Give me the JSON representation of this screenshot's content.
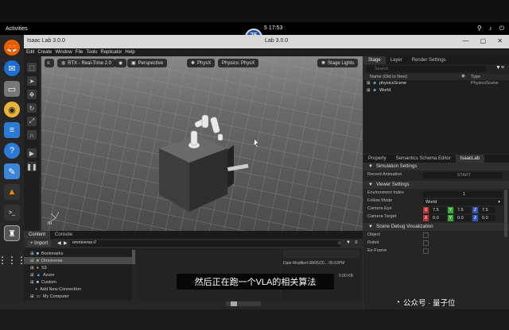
{
  "system": {
    "activities": "Activities",
    "clock": "5 17:53",
    "badge_value": "75",
    "badge_unit": "fps",
    "tray_icons": [
      "network-icon",
      "volume-icon",
      "power-icon"
    ]
  },
  "window": {
    "title": "Isaac Lab 3.0.0",
    "center_title": "Lab 3.0.0",
    "controls": [
      "minimize",
      "maximize",
      "close"
    ]
  },
  "menubar": [
    "Edit",
    "Create",
    "Window",
    "File",
    "Tools",
    "Replicator",
    "Help"
  ],
  "viewport": {
    "renderer": "RTX - Real-Time 2.0",
    "camera": "Perspective",
    "physx": "PhysX",
    "physics": "Physics: PhysX",
    "lights": "Stage Lights",
    "unit_label": "m"
  },
  "stage": {
    "tabs": [
      "Stage",
      "Layer",
      "Render Settings"
    ],
    "search_placeholder": "Search",
    "col_name": "Name (Old to New)",
    "col_type": "Type",
    "items": [
      {
        "name": "physicsScene",
        "type": "PhysicsScene"
      },
      {
        "name": "World",
        "type": ""
      }
    ]
  },
  "property": {
    "tabs": [
      "Property",
      "Semantics Schema Editor",
      "IsaacLab"
    ],
    "simulation_settings": "Simulation Settings",
    "record_animation": "Record Animation",
    "start": "START",
    "viewer_settings": "Viewer Settings",
    "env_index_label": "Environment Index",
    "env_index_value": "1",
    "follow_mode_label": "Follow Mode",
    "follow_mode_value": "World",
    "camera_eye_label": "Camera Eye",
    "camera_eye": [
      "7.5",
      "7.5",
      "7.5"
    ],
    "camera_target_label": "Camera Target",
    "camera_target": [
      "0.0",
      "0.0",
      "0.0"
    ],
    "axes": [
      "X",
      "Y",
      "Z"
    ],
    "scene_debug": "Scene Debug Visualization",
    "debug_items": [
      "Object",
      "Robot",
      "Ee Frame"
    ]
  },
  "content": {
    "tabs": [
      "Content",
      "Console"
    ],
    "import_label": "+ Import",
    "path": "omniverse://",
    "tree": [
      "Bookmarks",
      "Omniverse",
      "S3",
      "Azure",
      "Custom",
      "Add New Connection",
      "My Computer"
    ],
    "date_modified": "Date Modified 08/05/20... 05:53PM",
    "size": "0.00 KB"
  },
  "overlay": {
    "subtitle": "然后正在跑一个VLA的相关算法",
    "watermark": "公众号 · 量子位"
  },
  "colors": {
    "accent_blue": "#2c6fb3",
    "x_axis": "#b33",
    "y_axis": "#3a3",
    "z_axis": "#35b"
  }
}
